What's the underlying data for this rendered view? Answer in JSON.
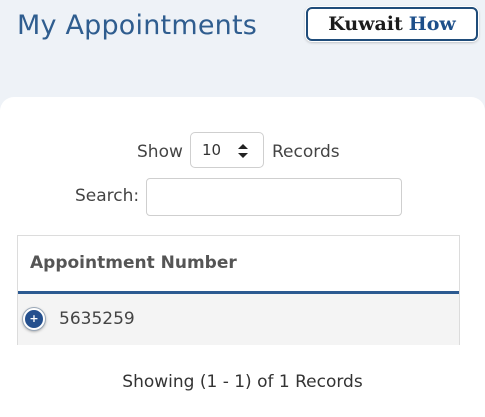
{
  "header": {
    "title": "My Appointments",
    "brand_word1": "Kuwait",
    "brand_word2": "How"
  },
  "controls": {
    "show_label": "Show",
    "page_size": "10",
    "records_label": "Records",
    "search_label": "Search:",
    "search_value": ""
  },
  "table": {
    "columns": [
      "Appointment Number"
    ],
    "rows": [
      {
        "expand_symbol": "+",
        "appointment_number": "5635259"
      }
    ]
  },
  "footer": {
    "summary": "Showing (1 - 1) of 1 Records"
  },
  "colors": {
    "accent": "#2c5a91",
    "title": "#2f5d8f",
    "background": "#eef2f7"
  }
}
